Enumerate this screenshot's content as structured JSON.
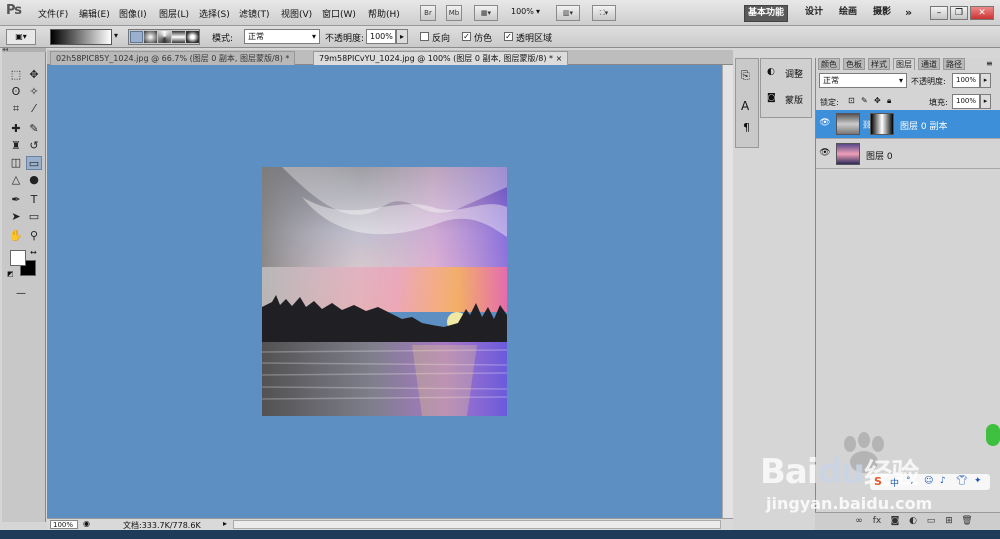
{
  "app": {
    "logo": "Ps"
  },
  "menu": [
    {
      "id": "file",
      "label": "文件(F)"
    },
    {
      "id": "edit",
      "label": "编辑(E)"
    },
    {
      "id": "image",
      "label": "图像(I)"
    },
    {
      "id": "layer",
      "label": "图层(L)"
    },
    {
      "id": "select",
      "label": "选择(S)"
    },
    {
      "id": "filter",
      "label": "滤镜(T)"
    },
    {
      "id": "view",
      "label": "视图(V)"
    },
    {
      "id": "window",
      "label": "窗口(W)"
    },
    {
      "id": "help",
      "label": "帮助(H)"
    }
  ],
  "menubar_buttons": {
    "bridge": "Br",
    "mini_bridge": "Mb",
    "zoom": "100%"
  },
  "workspaces": {
    "basic": "基本功能",
    "design": "设计",
    "painting": "绘画",
    "photography": "摄影",
    "more": "»"
  },
  "window_controls": {
    "minimize": "–",
    "restore": "❐",
    "close": "✕"
  },
  "options": {
    "mode_label": "模式:",
    "mode_value": "正常",
    "opacity_label": "不透明度:",
    "opacity_value": "100%",
    "reverse_label": "反向",
    "dither_label": "仿色",
    "transparency_label": "透明区域",
    "reverse_checked": false,
    "dither_checked": true,
    "transparency_checked": true
  },
  "documents": [
    {
      "title": "02h58PIC85Y_1024.jpg @ 66.7% (图层 0 副本, 图层蒙版/8) *",
      "active": false
    },
    {
      "title": "79m58PICvYU_1024.jpg @ 100% (图层 0 副本, 图层蒙版/8) *",
      "active": true
    }
  ],
  "tab_close": "×",
  "status": {
    "zoom": "100%",
    "doc_info": "文档:333.7K/778.6K"
  },
  "adjust_panel": {
    "adjust_label": "调整",
    "mask_label": "蒙版"
  },
  "layers_panel": {
    "tabs": [
      "颜色",
      "色板",
      "样式",
      "图层",
      "通道",
      "路径"
    ],
    "active_tab": "图层",
    "blend_mode": "正常",
    "opacity_label": "不透明度:",
    "opacity_value": "100%",
    "lock_label": "锁定:",
    "fill_label": "填充:",
    "fill_value": "100%",
    "layers": [
      {
        "name": "图层 0 副本",
        "selected": true,
        "has_mask": true
      },
      {
        "name": "图层 0",
        "selected": false,
        "has_mask": false
      }
    ]
  },
  "watermark": {
    "brand": "Bai",
    "paw": "du",
    "suffix": "经验",
    "url": "jingyan.baidu.com"
  },
  "colors": {
    "canvas_bg": "#5d8fc2",
    "selected_layer": "#3d8fd9",
    "menubar": "#d9d9d9"
  }
}
